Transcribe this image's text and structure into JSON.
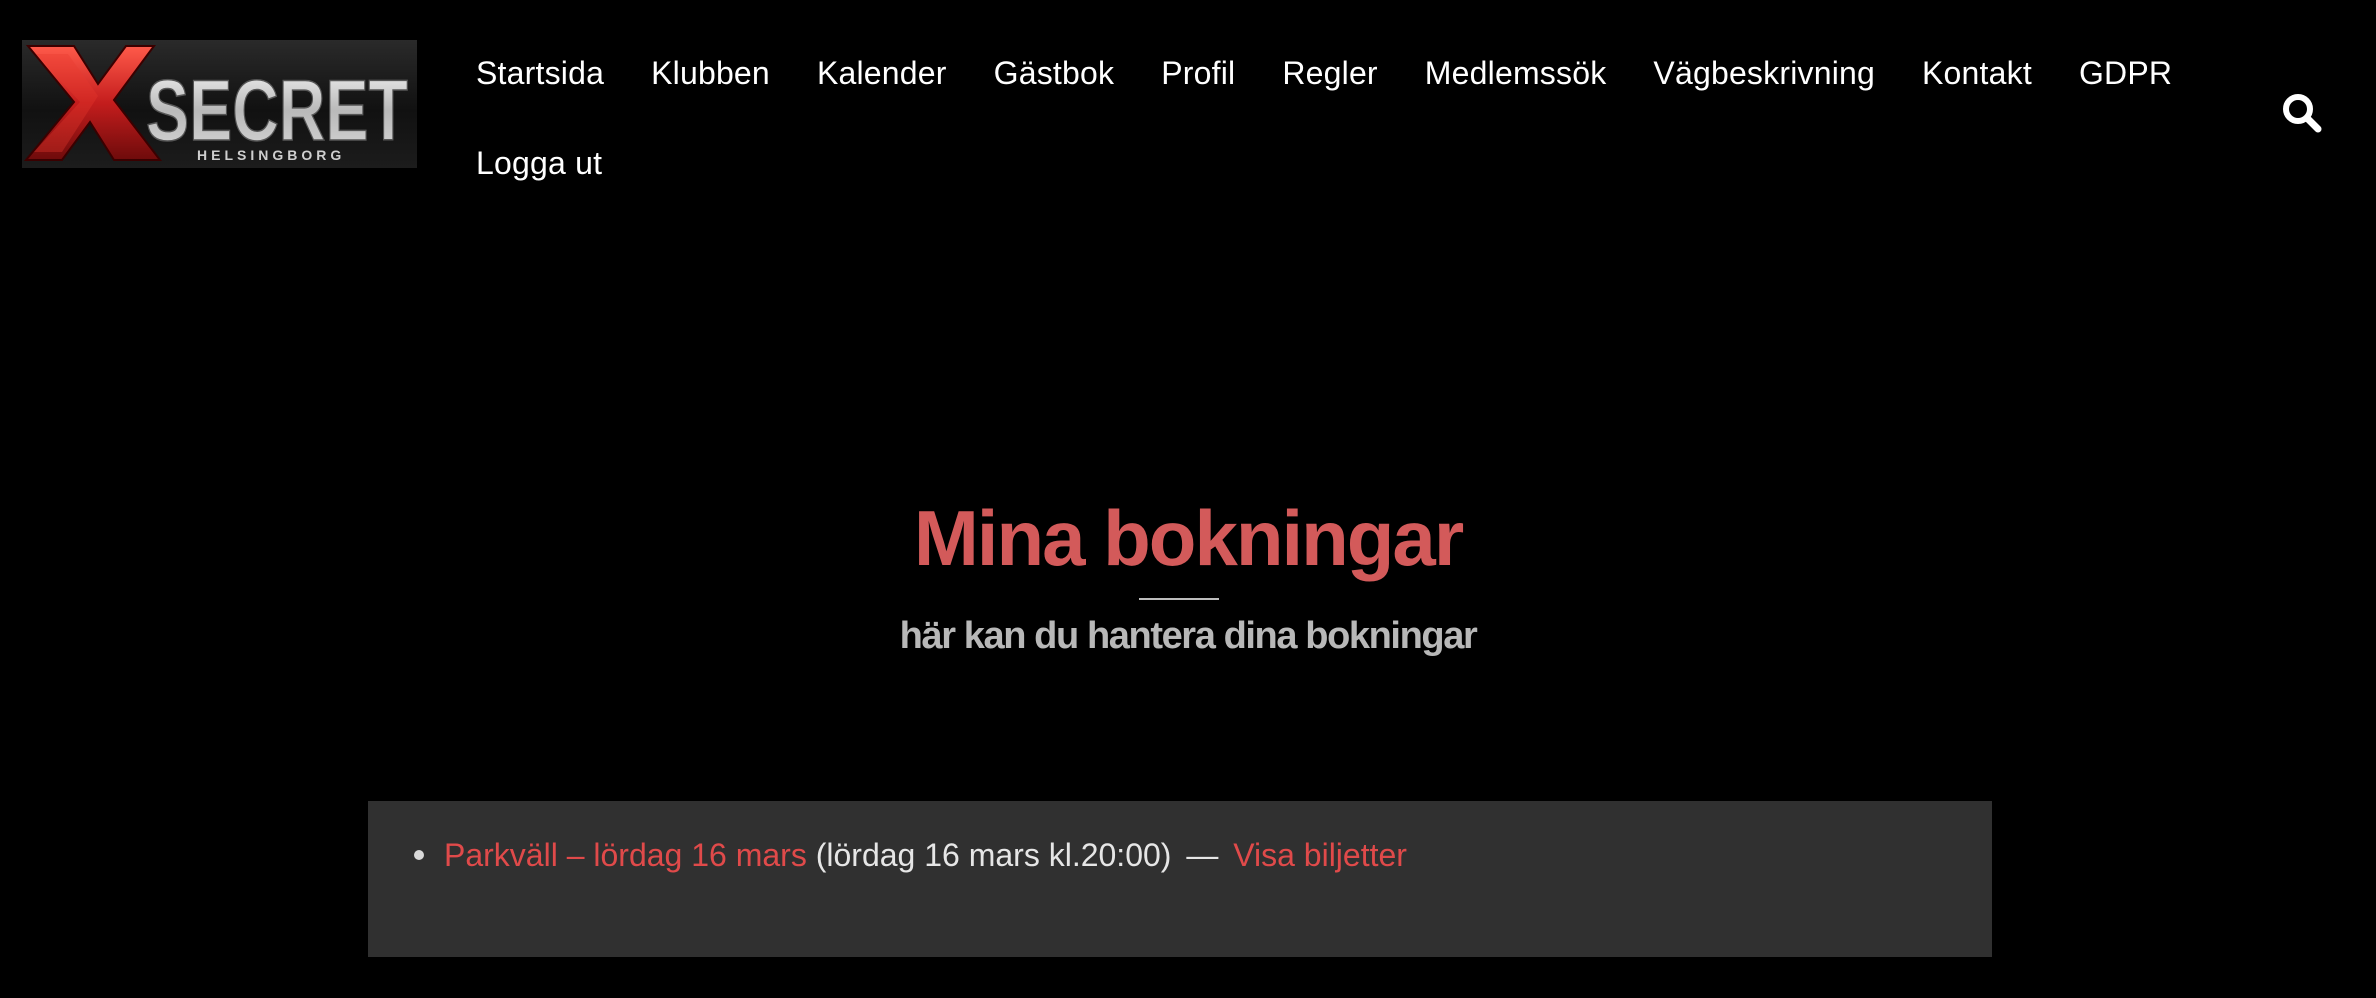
{
  "brand": {
    "logo_text": "SECRET",
    "logo_letter": "X",
    "logo_subtext": "HELSINGBORG"
  },
  "nav": {
    "items": [
      "Startsida",
      "Klubben",
      "Kalender",
      "Gästbok",
      "Profil",
      "Regler",
      "Medlemssök",
      "Vägbeskrivning",
      "Kontakt",
      "GDPR",
      "Logga ut"
    ],
    "search_icon": "search-icon"
  },
  "hero": {
    "title": "Mina bokningar",
    "subtitle": "här kan du hantera dina bokningar"
  },
  "bookings": [
    {
      "event_link": "Parkväll – lördag 16 mars",
      "datetime": "(lördag 16 mars kl.20:00)",
      "separator": "—",
      "action_link": "Visa biljetter"
    }
  ],
  "colors": {
    "background": "#000000",
    "accent": "#d35a5a",
    "link": "#e04a4a",
    "panel": "#303030"
  }
}
